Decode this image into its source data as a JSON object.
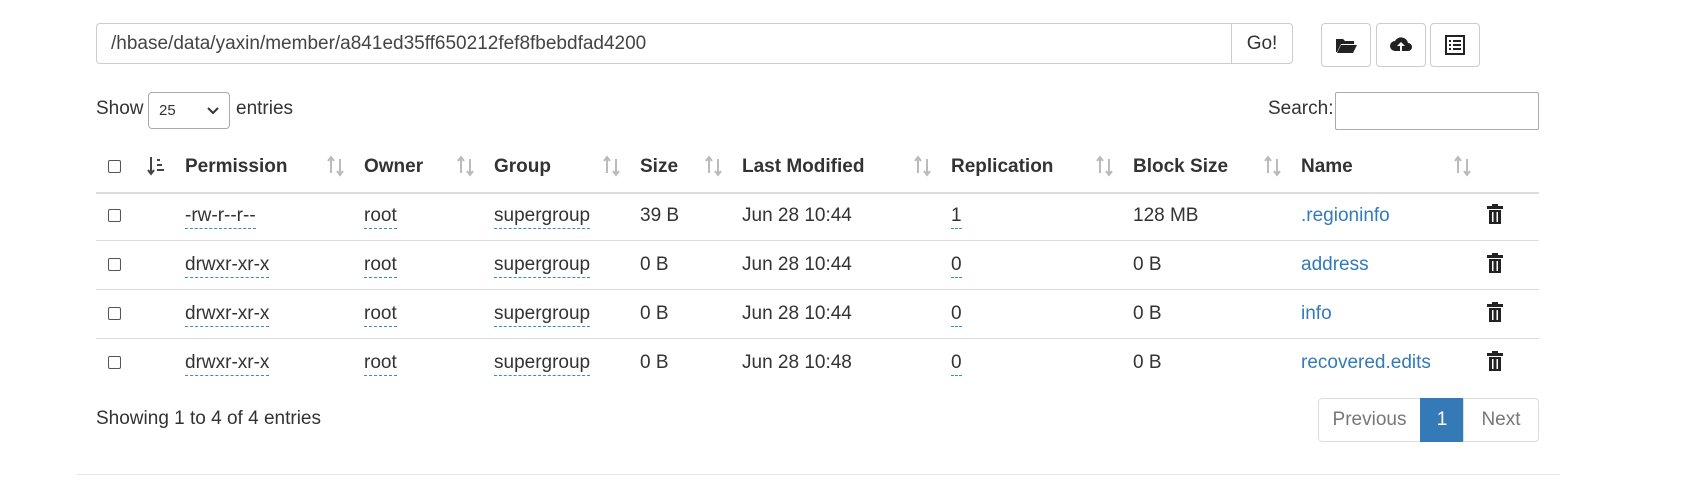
{
  "path_bar": {
    "path_value": "/hbase/data/yaxin/member/a841ed35ff650212fef8fbebdfad4200",
    "go_label": "Go!"
  },
  "toolbar": {
    "buttons": [
      {
        "icon": "folder-open-icon"
      },
      {
        "icon": "cloud-upload-icon"
      },
      {
        "icon": "list-icon"
      }
    ]
  },
  "length_control": {
    "show_label": "Show",
    "selected": "25",
    "entries_label": "entries"
  },
  "search": {
    "label": "Search:",
    "value": ""
  },
  "table": {
    "columns": [
      "Permission",
      "Owner",
      "Group",
      "Size",
      "Last Modified",
      "Replication",
      "Block Size",
      "Name"
    ],
    "rows": [
      {
        "permission": "-rw-r--r--",
        "owner": "root",
        "group": "supergroup",
        "size": "39 B",
        "modified": "Jun 28 10:44",
        "replication": "1",
        "block_size": "128 MB",
        "name": ".regioninfo"
      },
      {
        "permission": "drwxr-xr-x",
        "owner": "root",
        "group": "supergroup",
        "size": "0 B",
        "modified": "Jun 28 10:44",
        "replication": "0",
        "block_size": "0 B",
        "name": "address"
      },
      {
        "permission": "drwxr-xr-x",
        "owner": "root",
        "group": "supergroup",
        "size": "0 B",
        "modified": "Jun 28 10:44",
        "replication": "0",
        "block_size": "0 B",
        "name": "info"
      },
      {
        "permission": "drwxr-xr-x",
        "owner": "root",
        "group": "supergroup",
        "size": "0 B",
        "modified": "Jun 28 10:48",
        "replication": "0",
        "block_size": "0 B",
        "name": "recovered.edits"
      }
    ]
  },
  "footer": {
    "info": "Showing 1 to 4 of 4 entries",
    "previous": "Previous",
    "current_page": "1",
    "next": "Next"
  },
  "colors": {
    "link": "#337ab7",
    "active_page": "#337ab7"
  }
}
